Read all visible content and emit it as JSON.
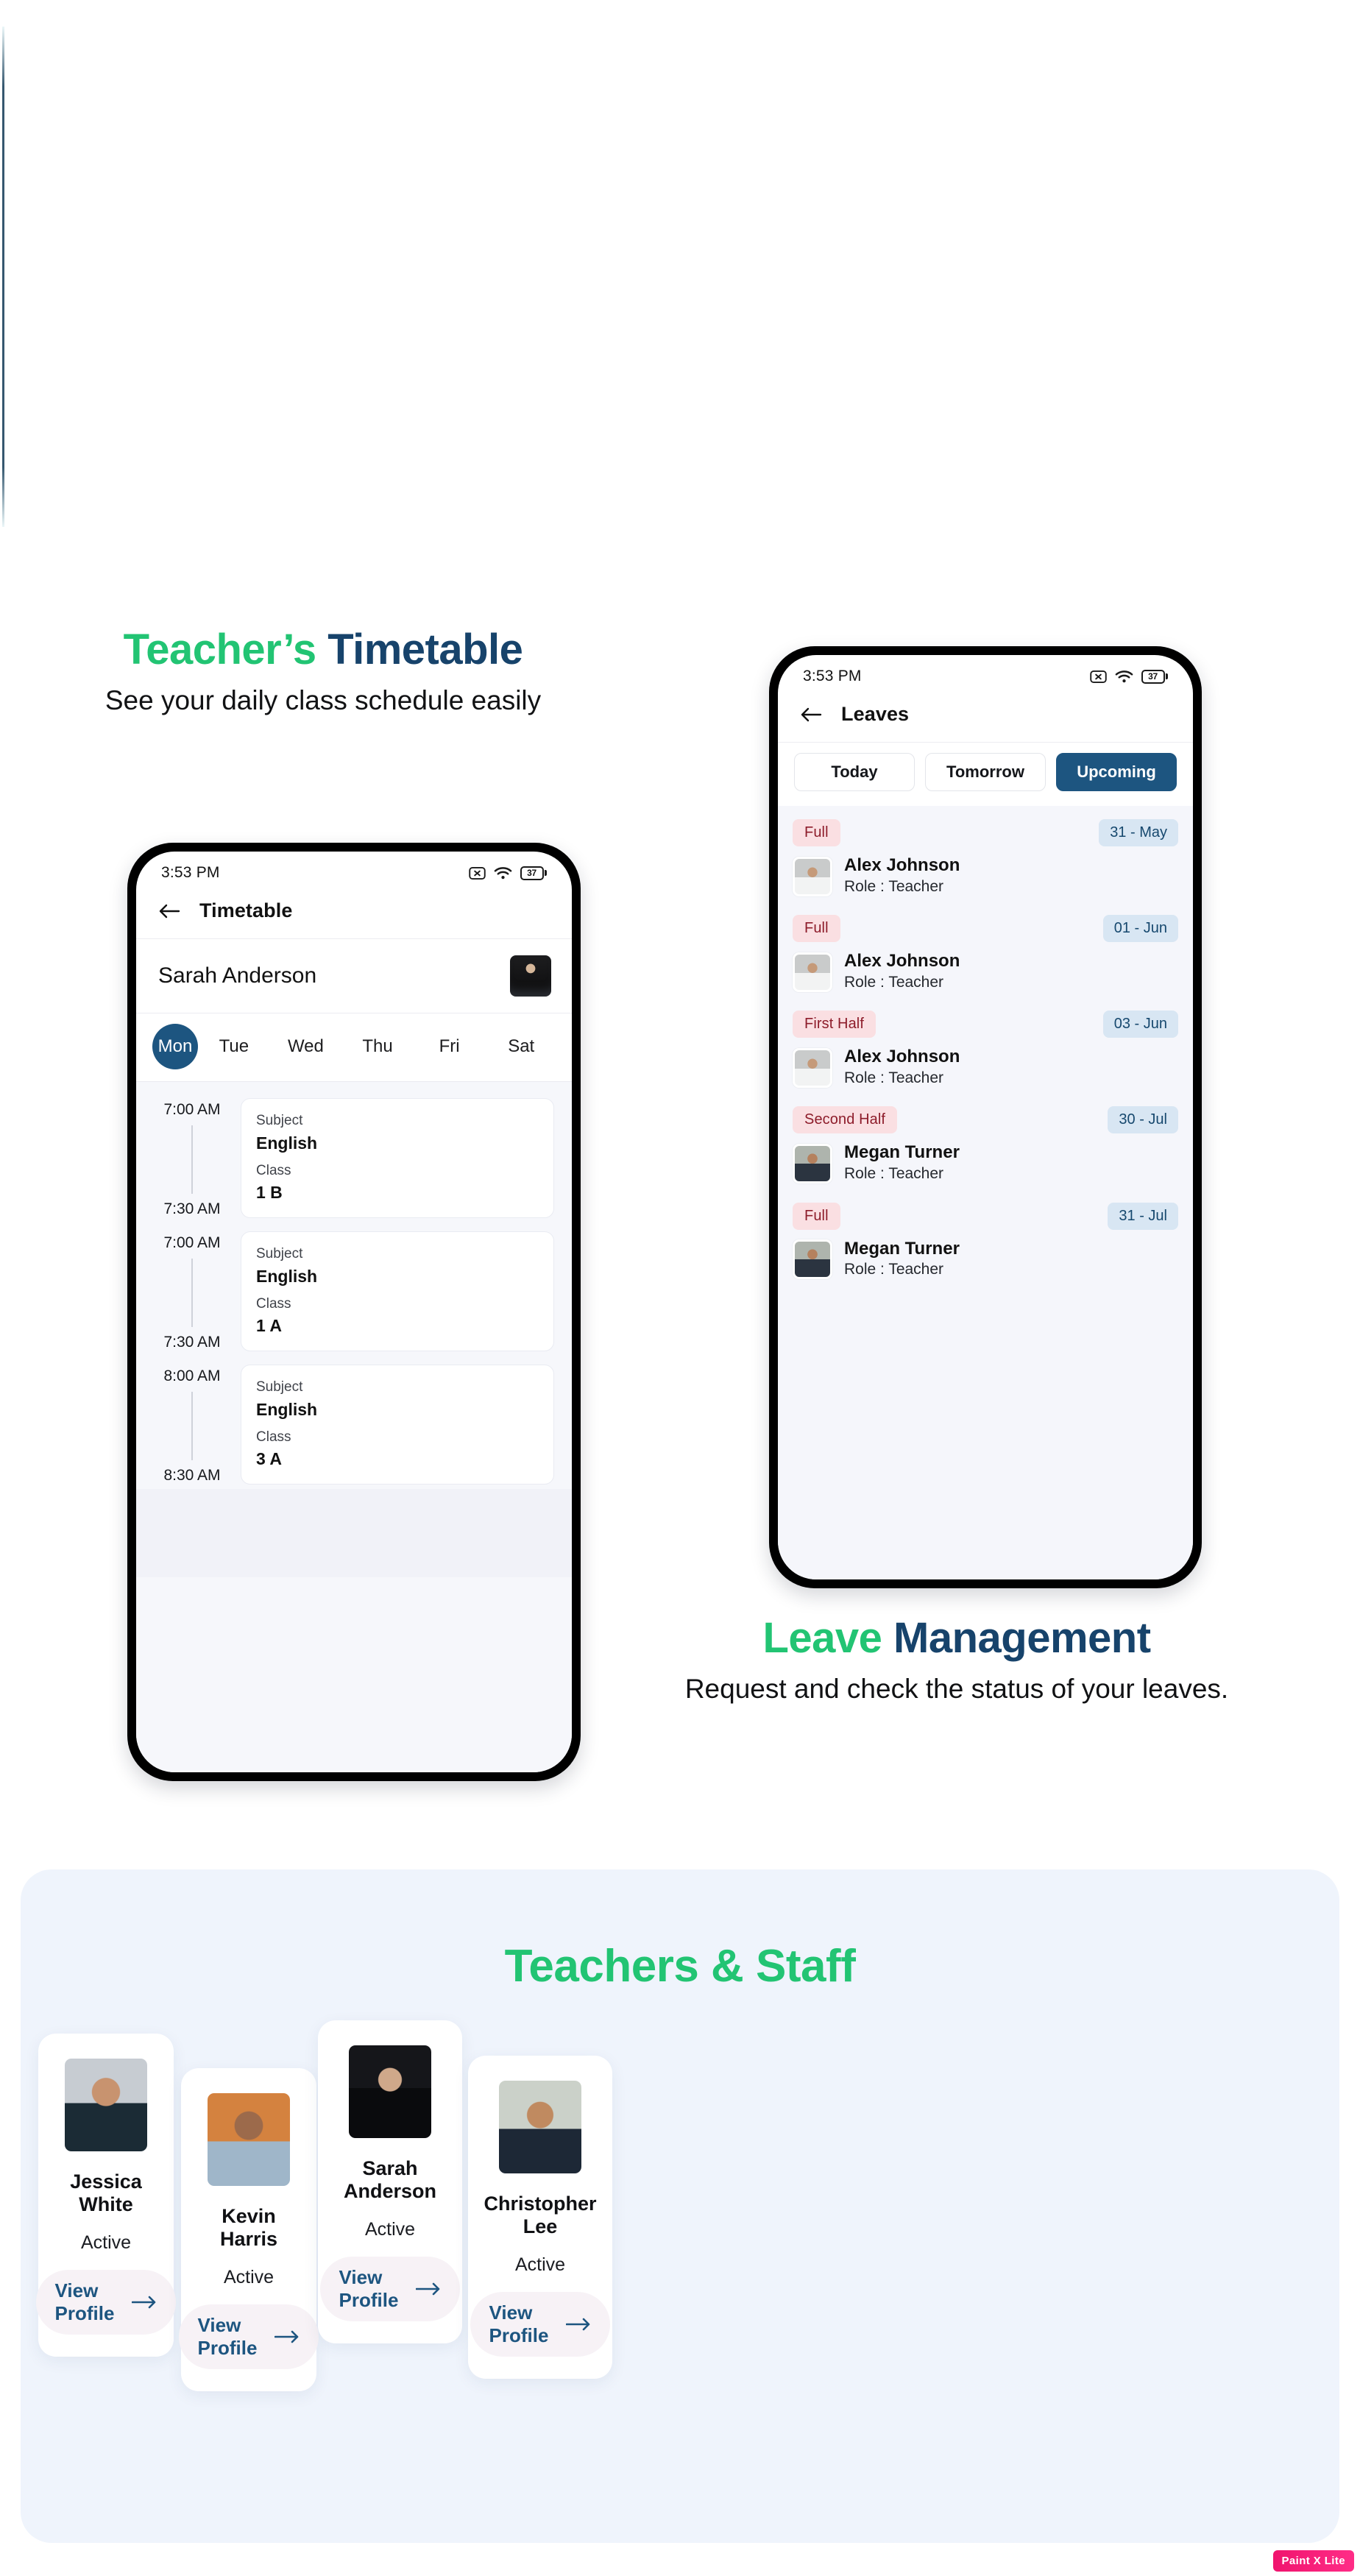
{
  "colors": {
    "accent_green": "#22c473",
    "heading_navy": "#17436b",
    "brand_blue": "#1d5580",
    "panel_bg": "#eff4fc",
    "leave_type_bg": "#fadfe2",
    "leave_type_text": "#8d1c2a",
    "leave_date_bg": "#d8e6f3",
    "leave_date_text": "#16486e"
  },
  "timetable_section": {
    "headline_accent": "Teacher’s",
    "headline_rest": " Timetable",
    "subline": "See your daily class schedule easily"
  },
  "timetable_phone": {
    "statusbar": {
      "time": "3:53 PM",
      "battery_level": "37",
      "icons": [
        "mute-icon",
        "wifi-icon",
        "battery-icon"
      ]
    },
    "appbar": {
      "back": "back-arrow-icon",
      "title": "Timetable"
    },
    "teacher": {
      "name": "Sarah Anderson",
      "avatar": "teacher-avatar"
    },
    "days": [
      {
        "label": "Mon",
        "active": true
      },
      {
        "label": "Tue",
        "active": false
      },
      {
        "label": "Wed",
        "active": false
      },
      {
        "label": "Thu",
        "active": false
      },
      {
        "label": "Fri",
        "active": false
      },
      {
        "label": "Sat",
        "active": false
      }
    ],
    "labels": {
      "subject": "Subject",
      "class": "Class"
    },
    "schedule": [
      {
        "start": "7:00 AM",
        "end": "7:30 AM",
        "subject": "English",
        "class": "1 B"
      },
      {
        "start": "7:00 AM",
        "end": "7:30 AM",
        "subject": "English",
        "class": "1 A"
      },
      {
        "start": "8:00 AM",
        "end": "8:30 AM",
        "subject": "English",
        "class": "3 A"
      }
    ]
  },
  "leaves_section": {
    "headline_accent": "Leave",
    "headline_rest": " Management",
    "subline": "Request and check the status of your leaves."
  },
  "leaves_phone": {
    "statusbar": {
      "time": "3:53 PM",
      "battery_level": "37",
      "icons": [
        "mute-icon",
        "wifi-icon",
        "battery-icon"
      ]
    },
    "appbar": {
      "back": "back-arrow-icon",
      "title": "Leaves"
    },
    "tabs": [
      {
        "label": "Today",
        "active": false
      },
      {
        "label": "Tomorrow",
        "active": false
      },
      {
        "label": "Upcoming",
        "active": true
      }
    ],
    "items": [
      {
        "type": "Full",
        "date": "31 - May",
        "name": "Alex Johnson",
        "role": "Role : Teacher",
        "photo": "ph-alex"
      },
      {
        "type": "Full",
        "date": "01 - Jun",
        "name": "Alex Johnson",
        "role": "Role : Teacher",
        "photo": "ph-alex"
      },
      {
        "type": "First Half",
        "date": "03 - Jun",
        "name": "Alex Johnson",
        "role": "Role : Teacher",
        "photo": "ph-alex"
      },
      {
        "type": "Second Half",
        "date": "30 - Jul",
        "name": "Megan Turner",
        "role": "Role : Teacher",
        "photo": "ph-megan"
      },
      {
        "type": "Full",
        "date": "31 - Jul",
        "name": "Megan Turner",
        "role": "Role : Teacher",
        "photo": "ph-megan"
      }
    ]
  },
  "staff_section": {
    "title": "Teachers & Staff",
    "cards": [
      {
        "name": "Jessica White",
        "status": "Active",
        "button": "View Profile",
        "photo": "sp-jessica"
      },
      {
        "name": "Kevin Harris",
        "status": "Active",
        "button": "View Profile",
        "photo": "sp-kevin"
      },
      {
        "name": "Sarah Anderson",
        "status": "Active",
        "button": "View Profile",
        "photo": "sp-sarah"
      },
      {
        "name": "Christopher Lee",
        "status": "Active",
        "button": "View Profile",
        "photo": "sp-chris"
      }
    ]
  },
  "watermark": {
    "label": "Paint X Lite"
  }
}
